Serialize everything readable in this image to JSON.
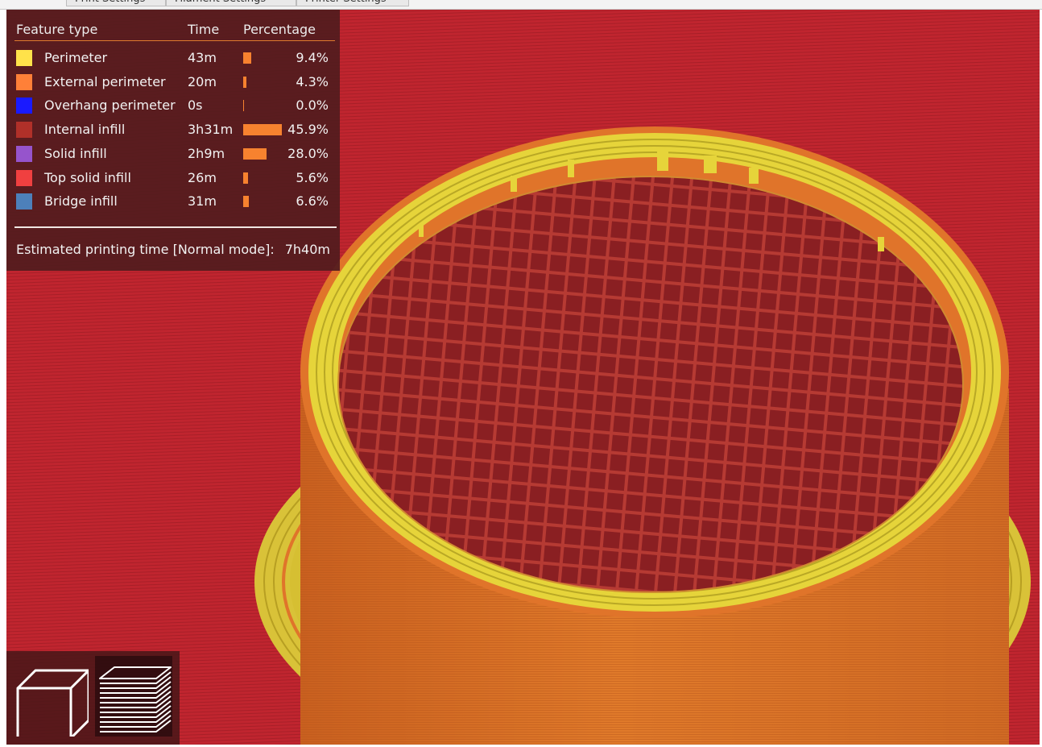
{
  "tabs": [
    {
      "label": "Print Settings"
    },
    {
      "label": "Filament Settings"
    },
    {
      "label": "Printer Settings"
    }
  ],
  "legend": {
    "headers": {
      "feature": "Feature type",
      "time": "Time",
      "percentage": "Percentage"
    },
    "rows": [
      {
        "label": "Perimeter",
        "time": "43m",
        "pct": "9.4%",
        "fraction": 0.094,
        "color": "#ffe24a"
      },
      {
        "label": "External perimeter",
        "time": "20m",
        "pct": "4.3%",
        "fraction": 0.043,
        "color": "#ff8038"
      },
      {
        "label": "Overhang perimeter",
        "time": "0s",
        "pct": "0.0%",
        "fraction": 0.0,
        "color": "#1a1aff"
      },
      {
        "label": "Internal infill",
        "time": "3h31m",
        "pct": "45.9%",
        "fraction": 0.459,
        "color": "#b03029"
      },
      {
        "label": "Solid infill",
        "time": "2h9m",
        "pct": "28.0%",
        "fraction": 0.28,
        "color": "#9654cc"
      },
      {
        "label": "Top solid infill",
        "time": "26m",
        "pct": "5.6%",
        "fraction": 0.056,
        "color": "#f04040"
      },
      {
        "label": "Bridge infill",
        "time": "31m",
        "pct": "6.6%",
        "fraction": 0.066,
        "color": "#4d80ba"
      }
    ],
    "estimate": {
      "label": "Estimated printing time [Normal mode]:",
      "value": "7h40m"
    }
  },
  "colors": {
    "bed": "#c0252f",
    "outer_wall": "#e0742a",
    "perimeter": "#e6d43a",
    "infill_floor": "#8a1f22",
    "infill_lines": "#b63a33",
    "bar": "#f7822f"
  },
  "toolbar": {
    "icons": [
      "3d-view-icon",
      "layers-view-icon"
    ]
  }
}
